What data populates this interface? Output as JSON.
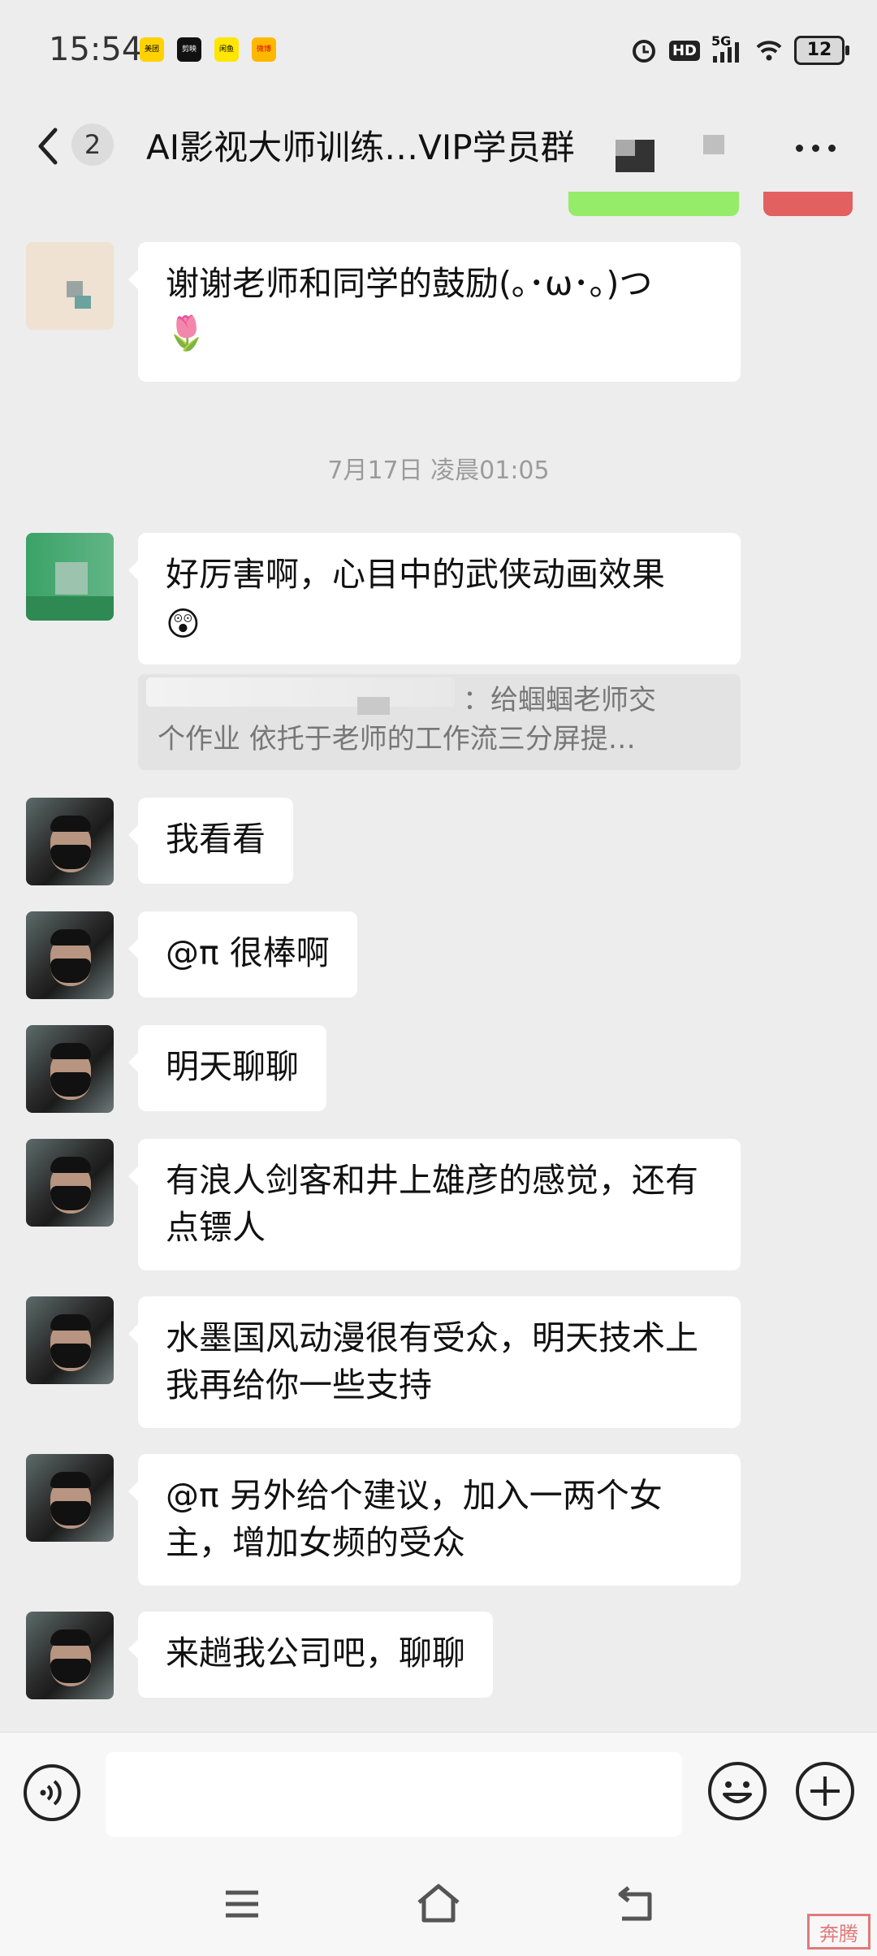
{
  "status_bar": {
    "time": "15:54",
    "app_icons": [
      "美团",
      "剪映",
      "闲鱼",
      "微博"
    ],
    "hd": "HD",
    "network": "5G",
    "battery": "12"
  },
  "header": {
    "unread_count": "2",
    "title": "AI影视大师训练…VIP学员群"
  },
  "messages": [
    {
      "avatar": "beige-blurred",
      "text": "谢谢老师和同学的鼓励(｡･ω･｡)つ",
      "emoji": "🌷"
    },
    {
      "type": "time",
      "text": "7月17日 凌晨01:05"
    },
    {
      "avatar": "green-blurred",
      "text": "好厉害啊，心目中的武侠动画效果",
      "emoji": "😲",
      "quote": {
        "line1": "：给蝈蝈老师交",
        "line2": "个作业  依托于老师的工作流三分屏提…"
      }
    },
    {
      "avatar": "masked-man",
      "text": "我看看"
    },
    {
      "avatar": "masked-man",
      "text": "@π 很棒啊"
    },
    {
      "avatar": "masked-man",
      "text": "明天聊聊"
    },
    {
      "avatar": "masked-man",
      "text": "有浪人剑客和井上雄彦的感觉，还有点镖人"
    },
    {
      "avatar": "masked-man",
      "text": "水墨国风动漫很有受众，明天技术上我再给你一些支持"
    },
    {
      "avatar": "masked-man",
      "text": "@π 另外给个建议，加入一两个女主，增加女频的受众"
    },
    {
      "avatar": "masked-man",
      "text": "来趟我公司吧，聊聊"
    }
  ],
  "input": {
    "value": ""
  },
  "watermark": "奔腾"
}
